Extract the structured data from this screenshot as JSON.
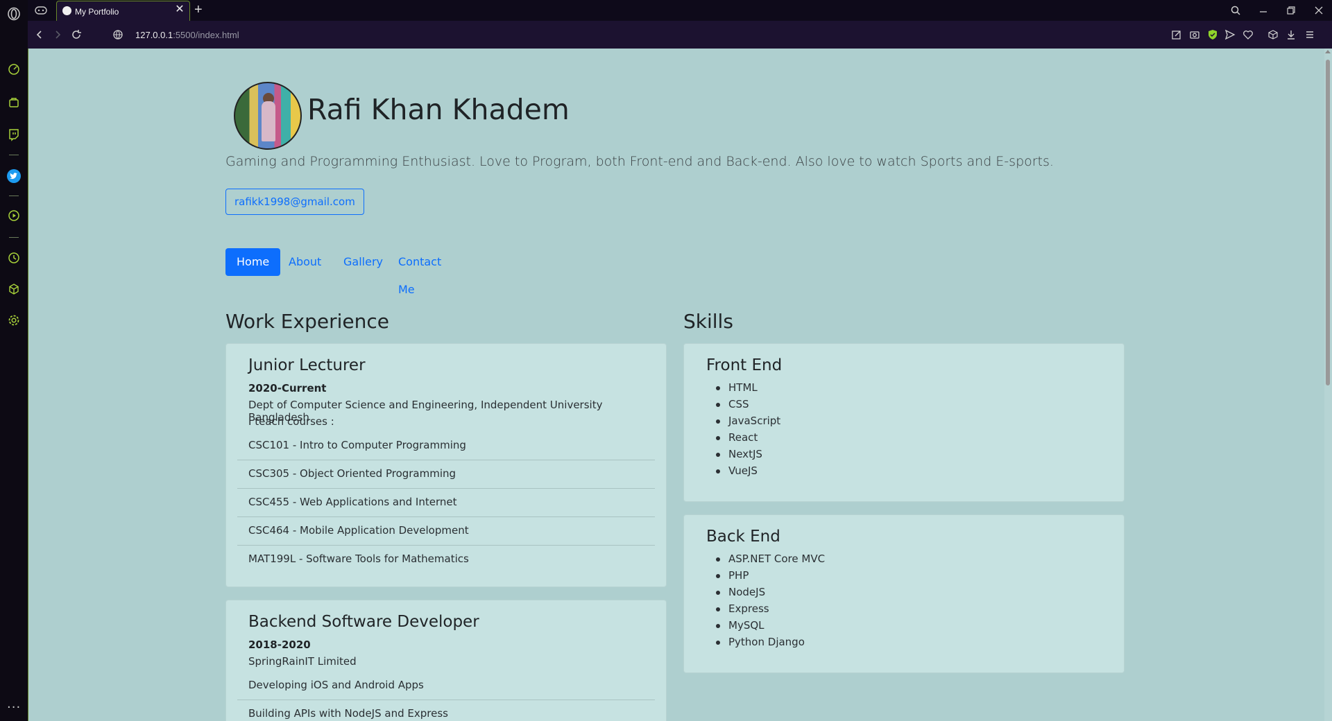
{
  "browser": {
    "tab_title": "My Portfolio",
    "url_host": "127.0.0.1",
    "url_rest": ":5500/index.html"
  },
  "profile": {
    "name": "Rafi Khan Khadem",
    "tagline": "Gaming and Programming Enthusiast. Love to Program, both Front-end and Back-end. Also love to watch Sports and E-sports.",
    "email": "rafikk1998@gmail.com"
  },
  "nav": {
    "items": [
      "Home",
      "About",
      "Gallery",
      "Contact Me"
    ],
    "active": "Home"
  },
  "work": {
    "title": "Work Experience",
    "jobs": [
      {
        "title": "Junior Lecturer",
        "period": "2020-Current",
        "org": "Dept of Computer Science and Engineering, Independent University Bangladesh",
        "note": "I teach courses :",
        "items": [
          "CSC101 - Intro to Computer Programming",
          "CSC305 - Object Oriented Programming",
          "CSC455 - Web Applications and Internet",
          "CSC464 - Mobile Application Development",
          "MAT199L - Software Tools for Mathematics"
        ]
      },
      {
        "title": "Backend Software Developer",
        "period": "2018-2020",
        "org": "SpringRainIT Limited",
        "items": [
          "Developing iOS and Android Apps",
          "Building APIs with NodeJS and Express"
        ]
      }
    ]
  },
  "skills": {
    "title": "Skills",
    "groups": [
      {
        "title": "Front End",
        "items": [
          "HTML",
          "CSS",
          "JavaScript",
          "React",
          "NextJS",
          "VueJS"
        ]
      },
      {
        "title": "Back End",
        "items": [
          "ASP.NET Core MVC",
          "PHP",
          "NodeJS",
          "Express",
          "MySQL",
          "Python Django"
        ]
      }
    ]
  },
  "colors": {
    "page_bg": "#aecfcf",
    "card_bg": "#c6e2e1",
    "accent": "#0d6efd",
    "browser_accent": "#a8d23a"
  }
}
